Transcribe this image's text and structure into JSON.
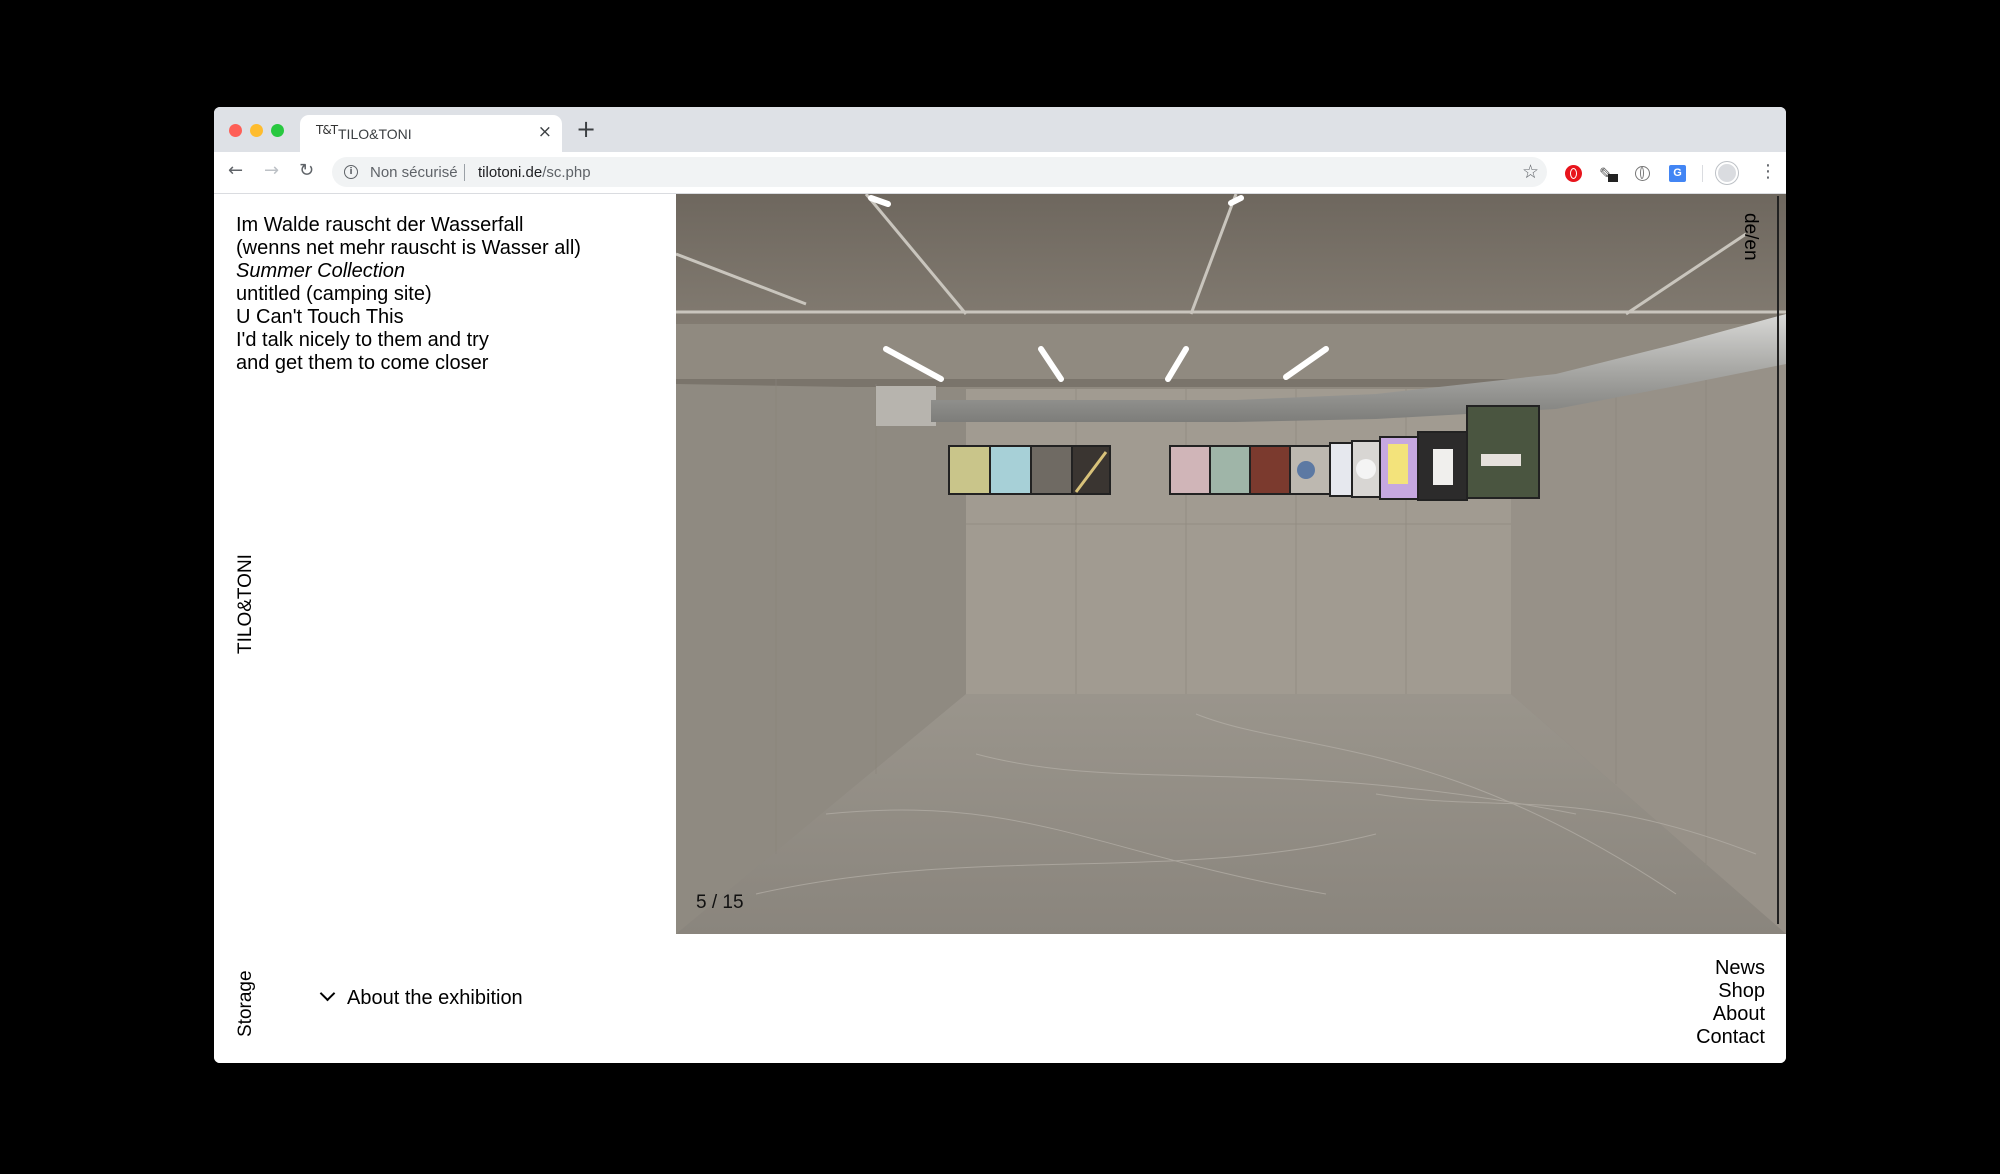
{
  "browser": {
    "tab": {
      "favicon": "T&T",
      "title": "TILO&TONI",
      "close_icon": "close-icon"
    },
    "new_tab_label": "+",
    "address": {
      "security_label": "Non sécurisé",
      "domain": "tilotoni.de",
      "path": "/sc.php"
    }
  },
  "page": {
    "titles": [
      {
        "text": "Im Walde rauscht der Wasserfall",
        "italic": false
      },
      {
        "text": "(wenns net mehr rauscht is Wasser all)",
        "italic": false
      },
      {
        "text": "Summer Collection",
        "italic": true
      },
      {
        "text": "untitled (camping site)",
        "italic": false
      },
      {
        "text": "U Can't Touch This",
        "italic": false
      },
      {
        "text": "I'd talk nicely to them and try",
        "italic": false
      },
      {
        "text": "and get them to come closer",
        "italic": false
      }
    ],
    "brand": "TILO&TONI",
    "section": "Storage",
    "language_toggle": "de/en",
    "gallery": {
      "counter": "5 / 15"
    },
    "about_toggle": "About the exhibition",
    "nav": [
      "News",
      "Shop",
      "About",
      "Contact"
    ]
  },
  "colors": {
    "background": "#000000",
    "page": "#ffffff",
    "text": "#000000",
    "concrete": "#8c8880"
  }
}
